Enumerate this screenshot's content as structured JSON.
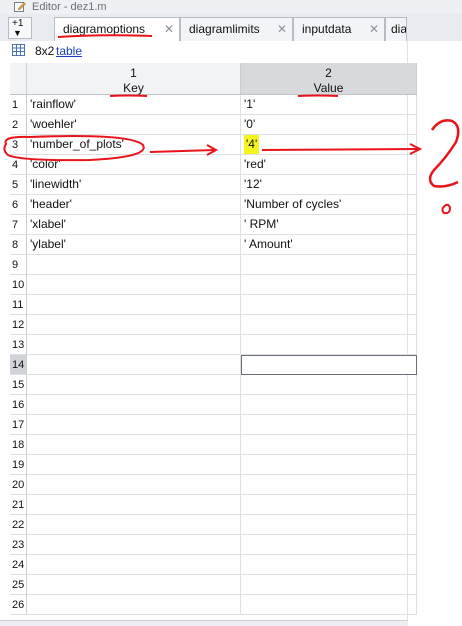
{
  "window": {
    "title": "Editor - dez1.m"
  },
  "tabs": [
    {
      "label": "diagramoptions",
      "active": true
    },
    {
      "label": "diagramlimits",
      "active": false
    },
    {
      "label": "inputdata",
      "active": false
    },
    {
      "label": "dia",
      "active": false
    }
  ],
  "nav": {
    "number": "+1"
  },
  "variable": {
    "dims": "8x2",
    "type": "table"
  },
  "table": {
    "columns": [
      {
        "index": "1",
        "name": "Key"
      },
      {
        "index": "2",
        "name": "Value"
      }
    ],
    "row_numbers": [
      "1",
      "2",
      "3",
      "4",
      "5",
      "6",
      "7",
      "8",
      "9",
      "10",
      "11",
      "12",
      "13",
      "14",
      "15",
      "16",
      "17",
      "18",
      "19",
      "20",
      "21",
      "22",
      "23",
      "24",
      "25",
      "26"
    ],
    "rows": [
      {
        "key": "'rainflow'",
        "value": "'1'"
      },
      {
        "key": "'woehler'",
        "value": "'0'"
      },
      {
        "key": "'number_of_plots'",
        "value": "'4'"
      },
      {
        "key": "'color'",
        "value": "'red'"
      },
      {
        "key": "'linewidth'",
        "value": "'12'"
      },
      {
        "key": "'header'",
        "value": "'Number of cycles'"
      },
      {
        "key": "'xlabel'",
        "value": "' RPM'"
      },
      {
        "key": "'ylabel'",
        "value": "' Amount'"
      }
    ],
    "selected_row": "14"
  },
  "colors": {
    "highlight": "#f5f51e",
    "annotation": "#e8141a",
    "link": "#1a3fb8"
  },
  "icons": {
    "editor": "editor-icon",
    "grid": "table-grid-icon",
    "close": "close-icon"
  }
}
